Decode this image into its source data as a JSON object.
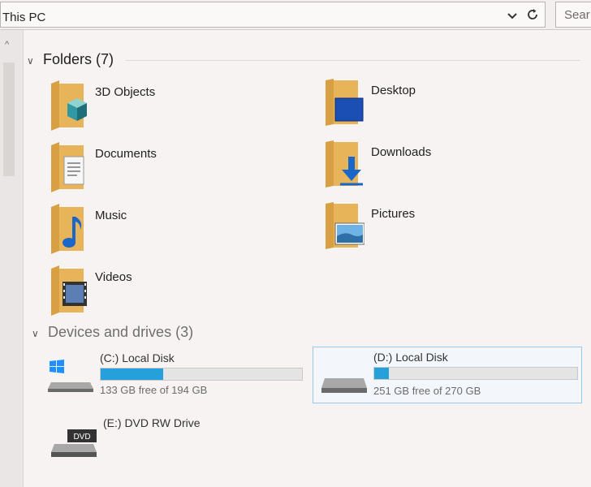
{
  "address": {
    "path": "This PC",
    "search_placeholder": "Sear"
  },
  "folders_group": {
    "title": "Folders (7)",
    "items": [
      {
        "label": "3D Objects",
        "icon": "3d-objects-icon"
      },
      {
        "label": "Desktop",
        "icon": "desktop-icon"
      },
      {
        "label": "Documents",
        "icon": "documents-icon"
      },
      {
        "label": "Downloads",
        "icon": "downloads-icon"
      },
      {
        "label": "Music",
        "icon": "music-icon"
      },
      {
        "label": "Pictures",
        "icon": "pictures-icon"
      },
      {
        "label": "Videos",
        "icon": "videos-icon"
      }
    ]
  },
  "drives_group": {
    "title": "Devices and drives (3)",
    "drives": [
      {
        "label": "(C:) Local Disk",
        "free_text": "133 GB free of 194 GB",
        "used_fraction": 0.31
      },
      {
        "label": "(D:) Local Disk",
        "free_text": "251 GB free of 270 GB",
        "used_fraction": 0.07
      },
      {
        "label": "(E:) DVD RW Drive"
      }
    ]
  },
  "colors": {
    "accent": "#26a0da",
    "folder": "#e8b45a",
    "selection_border": "#99c9ea"
  }
}
